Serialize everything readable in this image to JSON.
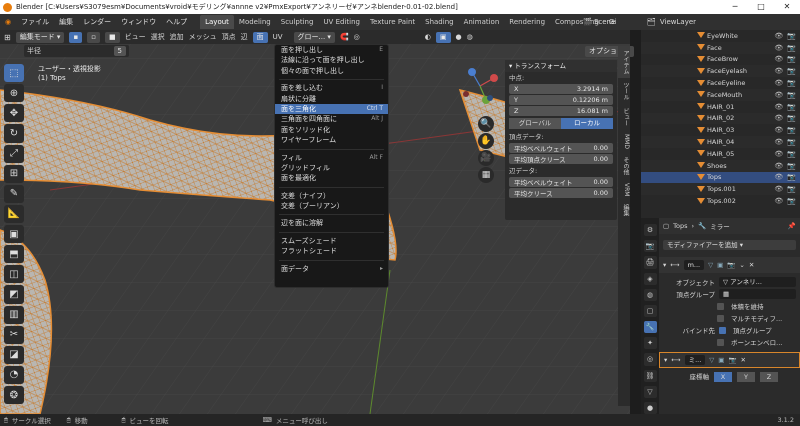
{
  "title": "Blender [C:¥Users¥S3079esm¥Documents¥vroid¥モデリング¥annne v2¥PmxExport¥アンネリーゼ¥アンネblender-0.01-02.blend]",
  "menubar": {
    "menus": [
      "ファイル",
      "編集",
      "レンダー",
      "ウィンドウ",
      "ヘルプ"
    ],
    "workspaces": [
      "Layout",
      "Modeling",
      "Sculpting",
      "UV Editing",
      "Texture Paint",
      "Shading",
      "Animation",
      "Rendering",
      "Compositing",
      "Gi"
    ],
    "active_workspace": "Layout",
    "scene": "Scene",
    "view_layer": "ViewLayer"
  },
  "viewport_header": {
    "mode": "編集モード",
    "menus": [
      "ビュー",
      "選択",
      "追加",
      "メッシュ",
      "頂点",
      "辺"
    ],
    "face_menu": "面",
    "uv_menu": "UV",
    "transform_orientation": "グロー...",
    "options": "オプション"
  },
  "tool_options": {
    "radius_label": "半径",
    "radius_value": "5"
  },
  "viewport_label": {
    "line1": "ユーザー・透視投影",
    "line2": "(1) Tops"
  },
  "face_menu": {
    "groups": [
      [
        {
          "label": "面を押し出し",
          "shortcut": "E"
        },
        {
          "label": "法線に沿って面を押し出し",
          "shortcut": ""
        },
        {
          "label": "個々の面で押し出し",
          "shortcut": ""
        }
      ],
      [
        {
          "label": "面を差し込む",
          "shortcut": "I"
        },
        {
          "label": "扇状に分離",
          "shortcut": ""
        },
        {
          "label": "面を三角化",
          "shortcut": "Ctrl T"
        },
        {
          "label": "三角面を四角面に",
          "shortcut": "Alt J"
        },
        {
          "label": "面をソリッド化",
          "shortcut": ""
        },
        {
          "label": "ワイヤーフレーム",
          "shortcut": ""
        }
      ],
      [
        {
          "label": "フィル",
          "shortcut": "Alt F"
        },
        {
          "label": "グリッドフィル",
          "shortcut": ""
        },
        {
          "label": "面を最適化",
          "shortcut": ""
        }
      ],
      [
        {
          "label": "交差（ナイフ）",
          "shortcut": ""
        },
        {
          "label": "交差（ブーリアン）",
          "shortcut": ""
        }
      ],
      [
        {
          "label": "辺を面に溶解",
          "shortcut": ""
        }
      ],
      [
        {
          "label": "スムーズシェード",
          "shortcut": ""
        },
        {
          "label": "フラットシェード",
          "shortcut": ""
        }
      ],
      [
        {
          "label": "面データ",
          "shortcut": "▸"
        }
      ]
    ],
    "highlighted": "面を三角化"
  },
  "transform_panel": {
    "title": "トランスフォーム",
    "median_label": "中点:",
    "x_label": "X",
    "x_value": "3.2914 m",
    "y_label": "Y",
    "y_value": "0.12206 m",
    "z_label": "Z",
    "z_value": "16.081 m",
    "global": "グローバル",
    "local": "ローカル",
    "vertex_data": "頂点データ:",
    "vertex_bevel": "平均ベベルウェイト",
    "vertex_bevel_value": "0.00",
    "vertex_crease": "平均頂点クリース",
    "vertex_crease_value": "0.00",
    "edge_data": "辺データ:",
    "edge_bevel": "平均ベベルウェイト",
    "edge_bevel_value": "0.00",
    "edge_crease": "平均クリース",
    "edge_crease_value": "0.00"
  },
  "npanel_tabs": [
    "アイテム",
    "ツール",
    "ビュー",
    "MMD",
    "その他",
    "VRM",
    "編集"
  ],
  "outliner": {
    "items": [
      {
        "name": "EyeWhite",
        "selected": false
      },
      {
        "name": "Face",
        "selected": false
      },
      {
        "name": "FaceBrow",
        "selected": false
      },
      {
        "name": "FaceEyelash",
        "selected": false
      },
      {
        "name": "FaceEyeline",
        "selected": false
      },
      {
        "name": "FaceMouth",
        "selected": false
      },
      {
        "name": "HAIR_01",
        "selected": false
      },
      {
        "name": "HAIR_02",
        "selected": false
      },
      {
        "name": "HAIR_03",
        "selected": false
      },
      {
        "name": "HAIR_04",
        "selected": false
      },
      {
        "name": "HAIR_05",
        "selected": false
      },
      {
        "name": "Shoes",
        "selected": false
      },
      {
        "name": "Tops",
        "selected": true
      },
      {
        "name": "Tops.001",
        "selected": false
      },
      {
        "name": "Tops.002",
        "selected": false
      }
    ]
  },
  "properties": {
    "object": "Tops",
    "modifier_name": "ミラー",
    "add_modifier": "モディファイアーを追加",
    "mod1_name": "m...",
    "object_label": "オブジェクト",
    "object_value": "アンネリ...",
    "vgroup_label": "頂点グループ",
    "volume": "体積を維持",
    "multi": "マルチモディフ...",
    "bind_label": "バインド先",
    "bind_vgroup": "頂点グループ",
    "bind_bone": "ボーンエンベロ...",
    "mod2_name": "ミ...",
    "axis_label": "座標軸",
    "axes": [
      "X",
      "Y",
      "Z"
    ]
  },
  "statusbar": {
    "select": "サークル選択",
    "move": "移動",
    "rotate": "ビューを回転",
    "menu": "メニュー呼び出し",
    "version": "3.1.2"
  },
  "colors": {
    "accent": "#4772b3",
    "mesh": "#e58d34"
  }
}
